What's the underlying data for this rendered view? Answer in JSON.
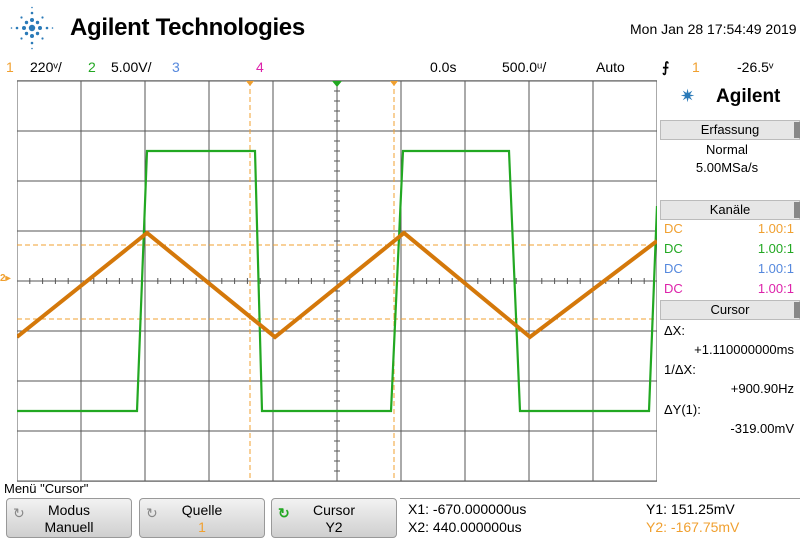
{
  "header": {
    "brand": "Agilent Technologies",
    "datetime": "Mon Jan 28 17:54:49 2019"
  },
  "status": {
    "ch1_num": "1",
    "ch1_scale": "220ᵛ/",
    "ch2_num": "2",
    "ch2_scale": "5.00V/",
    "ch3_num": "3",
    "ch4_num": "4",
    "time_pos": "0.0s",
    "time_scale": "500.0ᵘ/",
    "trig_mode": "Auto",
    "trig_src": "1",
    "trig_level": "-26.5ᵛ"
  },
  "side": {
    "logo_text": "Agilent",
    "acq_head": "Erfassung",
    "acq_mode": "Normal",
    "acq_rate": "5.00MSa/s",
    "chan_head": "Kanäle",
    "channels": [
      {
        "coupling": "DC",
        "ratio": "1.00:1",
        "color": "#f0a030"
      },
      {
        "coupling": "DC",
        "ratio": "1.00:1",
        "color": "#22a822"
      },
      {
        "coupling": "DC",
        "ratio": "1.00:1",
        "color": "#5588dd"
      },
      {
        "coupling": "DC",
        "ratio": "1.00:1",
        "color": "#dd22aa"
      }
    ],
    "cursor_head": "Cursor",
    "dx_label": "ΔX:",
    "dx_value": "+1.110000000ms",
    "inv_dx_label": "1/ΔX:",
    "inv_dx_value": "+900.90Hz",
    "dy_label": "ΔY(1):",
    "dy_value": "-319.00mV"
  },
  "menu": {
    "title": "Menü \"Cursor\"",
    "keys": [
      {
        "label": "Modus",
        "value": "Manuell"
      },
      {
        "label": "Quelle",
        "value": "1"
      },
      {
        "label": "Cursor",
        "value": "Y2"
      }
    ]
  },
  "readout": {
    "x1": "X1: -670.000000us",
    "x2": "X2: 440.000000us",
    "y1": "Y1: 151.25mV",
    "y2": "Y2: -167.75mV"
  },
  "colors": {
    "ch1": "#f0a030",
    "ch1_trace": "#d4780a",
    "ch2": "#22a822",
    "ch3": "#5588dd",
    "ch4": "#dd22aa",
    "cursor": "#f0a030"
  }
}
